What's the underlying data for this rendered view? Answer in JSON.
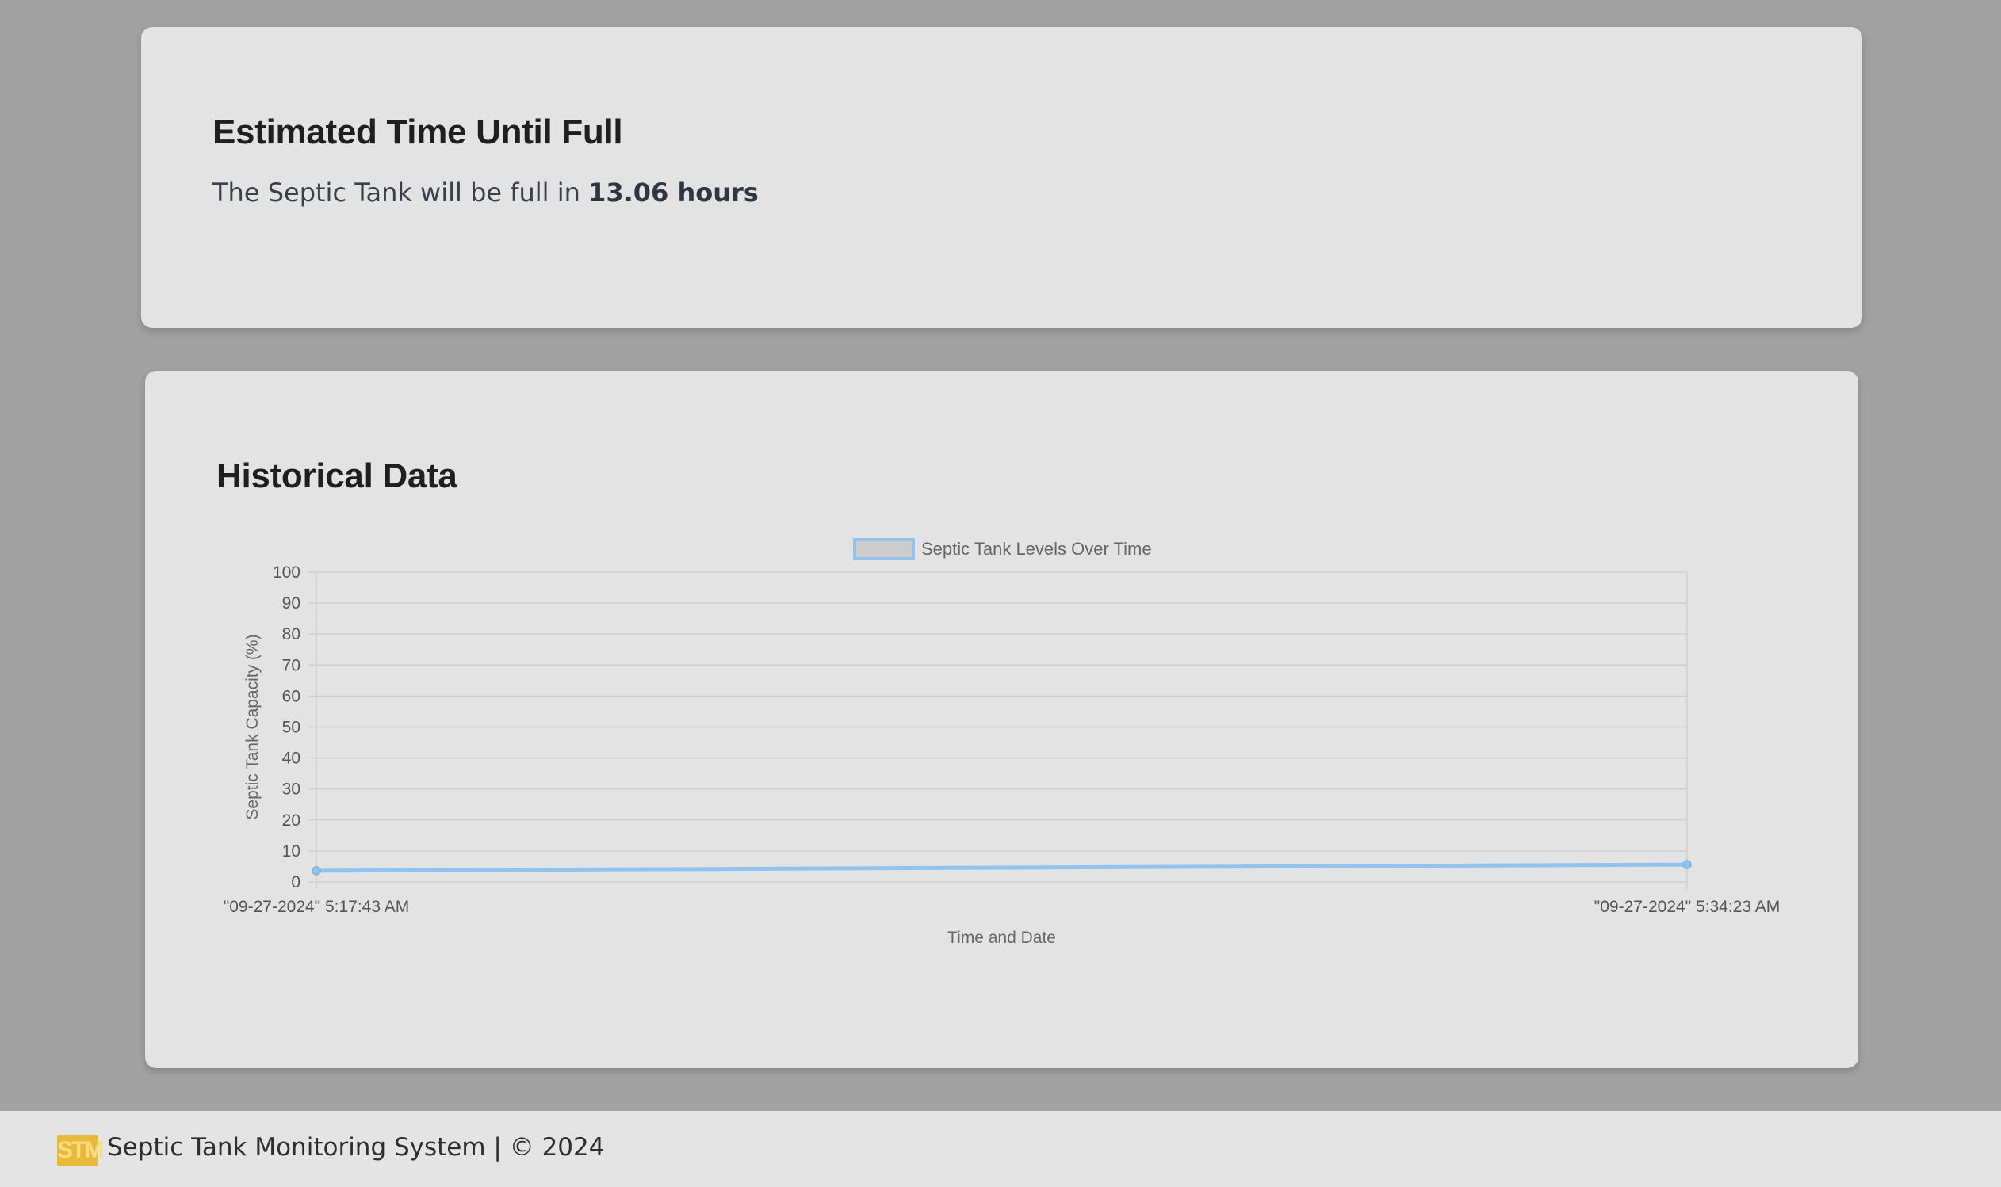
{
  "estimate": {
    "title": "Estimated Time Until Full",
    "text_prefix": "The Septic Tank will be full in",
    "value": "13.06 hours"
  },
  "history": {
    "title": "Historical Data"
  },
  "chart_data": {
    "type": "line",
    "legend": "Septic Tank Levels Over Time",
    "legend_position": "top-center",
    "xlabel": "Time and Date",
    "ylabel": "Septic Tank Capacity (%)",
    "x": [
      "\"09-27-2024\" 5:17:43 AM",
      "\"09-27-2024\" 5:34:23 AM"
    ],
    "series": [
      {
        "name": "Septic Tank Levels Over Time",
        "values": [
          3.6,
          5.6
        ],
        "color": "#90c4ee"
      }
    ],
    "ylim": [
      0,
      100
    ],
    "yticks": [
      0,
      10,
      20,
      30,
      40,
      50,
      60,
      70,
      80,
      90,
      100
    ],
    "grid": true,
    "colors": {
      "line": "#90c4ee",
      "grid": "#cfcfcf",
      "legend_fill": "#cccccc"
    }
  },
  "footer": {
    "logo_text": "STM",
    "text": "Septic Tank Monitoring System | © 2024"
  }
}
